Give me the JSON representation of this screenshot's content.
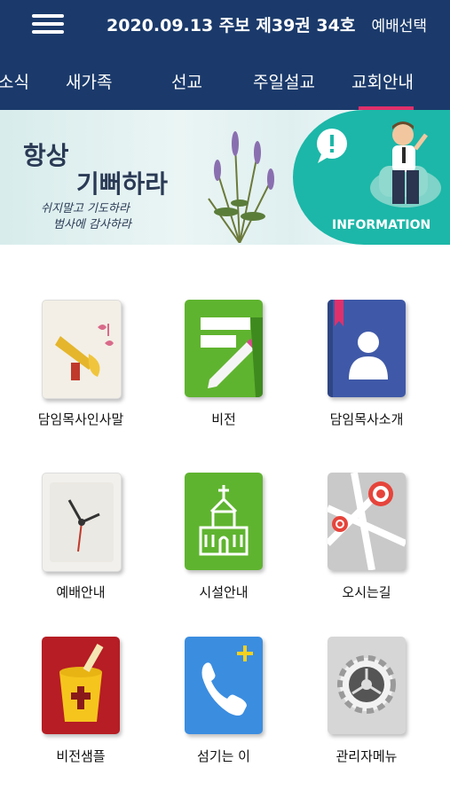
{
  "header": {
    "title": "2020.09.13 주보 제39권 34호",
    "select_label": "예배선택"
  },
  "tabs": [
    "소식",
    "새가족",
    "선교",
    "주일설교",
    "교회안내"
  ],
  "active_tab": "교회안내",
  "banner": {
    "line1": "항상",
    "line2": "기뻐하라",
    "line3": "쉬지말고 기도하라",
    "line4": "범사에 감사하라",
    "info_label": "INFORMATION"
  },
  "menu": [
    {
      "label": "담임목사인사말",
      "icon": "trumpet-icon",
      "color": "#f3efe6"
    },
    {
      "label": "비전",
      "icon": "notepad-pencil-icon",
      "color": "#5fb42f"
    },
    {
      "label": "담임목사소개",
      "icon": "contact-book-icon",
      "color": "#3f59a8"
    },
    {
      "label": "예배안내",
      "icon": "clock-icon",
      "color": "#f1f0ec"
    },
    {
      "label": "시설안내",
      "icon": "church-icon",
      "color": "#5fb42f"
    },
    {
      "label": "오시는길",
      "icon": "map-pin-icon",
      "color": "#c9c9c9"
    },
    {
      "label": "비전샘플",
      "icon": "bucket-cross-icon",
      "color": "#b61d24"
    },
    {
      "label": "섬기는 이",
      "icon": "phone-icon",
      "color": "#3b8de0"
    },
    {
      "label": "관리자메뉴",
      "icon": "gear-icon",
      "color": "#d6d6d6"
    }
  ]
}
